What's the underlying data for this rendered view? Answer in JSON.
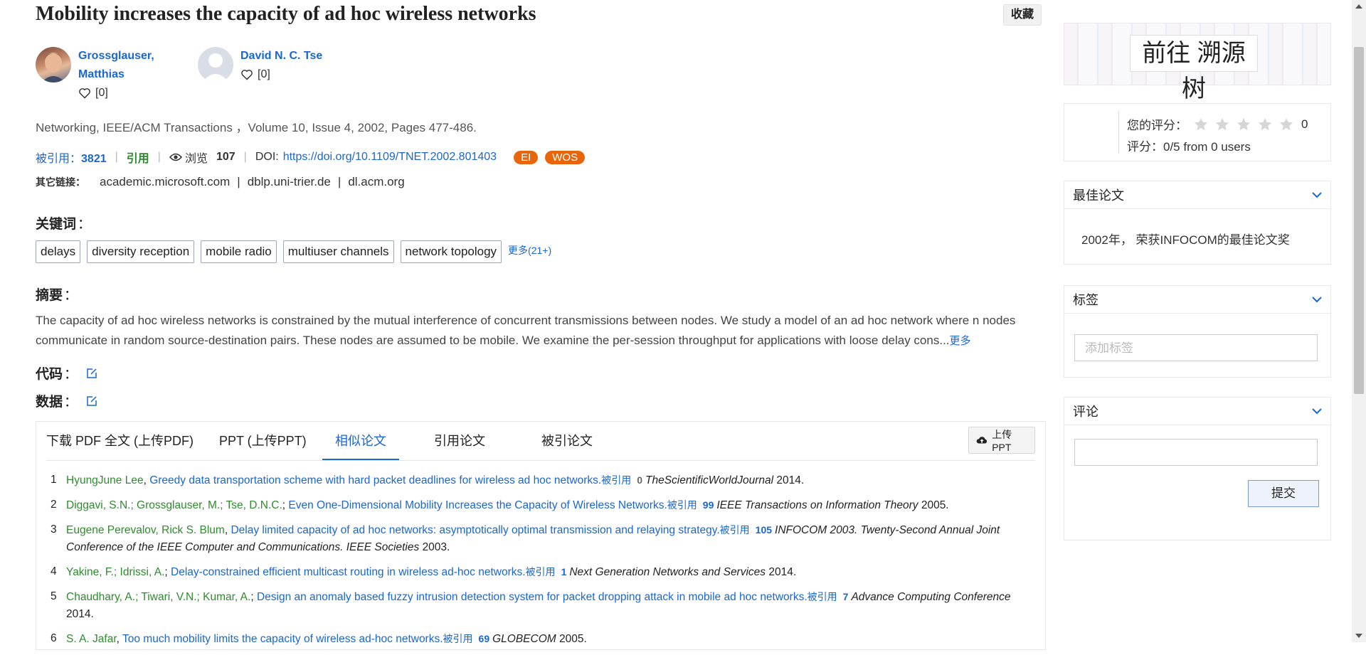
{
  "paper": {
    "title": "Mobility increases the capacity of ad hoc wireless networks",
    "favorite_label": "收藏",
    "authors": [
      {
        "name": "Grossglauser, Matthias",
        "name_line1": "Grossglauser,",
        "name_line2": "Matthias",
        "likes": "[0]"
      },
      {
        "name": "David N. C. Tse",
        "likes": "[0]"
      }
    ],
    "venue": "Networking, IEEE/ACM Transactions ，Volume 10, Issue 4, 2002, Pages 477-486.",
    "metrics": {
      "cited_label": "被引用：",
      "cited_count": "3821",
      "cite_label": "引用",
      "views_label": "浏览",
      "views": "107",
      "doi_label": "DOI:",
      "doi": "https://doi.org/10.1109/TNET.2002.801403",
      "badges": [
        "EI",
        "WOS"
      ]
    },
    "other_links": {
      "label": "其它链接：",
      "items": [
        "academic.microsoft.com",
        "dblp.uni-trier.de",
        "dl.acm.org"
      ]
    },
    "keywords_label": "关键词",
    "keywords": [
      "delays",
      "diversity reception",
      "mobile radio",
      "multiuser channels",
      "network topology"
    ],
    "keywords_more": "更多(21+)",
    "abstract_label": "摘要",
    "abstract": "The capacity of ad hoc wireless networks is constrained by the mutual interference of concurrent transmissions between nodes. We study a model of an ad hoc network where n nodes communicate in random source-destination pairs. These nodes are assumed to be mobile. We examine the per-session throughput for applications with loose delay cons...",
    "abstract_more": "更多",
    "code_label": "代码",
    "data_label": "数据",
    "colon": "："
  },
  "tabs": {
    "items": [
      "下载 PDF 全文 (上传PDF)",
      "PPT (上传PPT)",
      "相似论文",
      "引用论文",
      "被引论文"
    ],
    "active": "相似论文",
    "upload_ppt": "上传PPT"
  },
  "similar_papers": [
    {
      "num": "1",
      "authors": "HyungJune Lee",
      "title": "Greedy data transportation scheme with hard packet deadlines for wireless ad hoc networks.",
      "cite_label": "被引用",
      "cites": "0",
      "venue": "TheScientificWorldJournal",
      "year": "2014."
    },
    {
      "num": "2",
      "authors": "Diggavi, S.N.; Grossglauser, M.; Tse, D.N.C.",
      "title": "Even One-Dimensional Mobility Increases the Capacity of Wireless Networks.",
      "cite_label": "被引用",
      "cites": "99",
      "venue": "IEEE Transactions on Information Theory",
      "year": "2005."
    },
    {
      "num": "3",
      "authors": "Eugene Perevalov, Rick S. Blum",
      "title": "Delay limited capacity of ad hoc networks: asymptotically optimal transmission and relaying strategy.",
      "cite_label": "被引用",
      "cites": "105",
      "venue": "INFOCOM 2003. Twenty-Second Annual Joint Conference of the IEEE Computer and Communications. IEEE Societies",
      "year": "2003."
    },
    {
      "num": "4",
      "authors": "Yakine, F.; Idrissi, A.",
      "title": "Delay-constrained efficient multicast routing in wireless ad-hoc networks.",
      "cite_label": "被引用",
      "cites": "1",
      "venue": "Next Generation Networks and Services",
      "year": "2014."
    },
    {
      "num": "5",
      "authors": "Chaudhary, A.; Tiwari, V.N.; Kumar, A.",
      "title": "Design an anomaly based fuzzy intrusion detection system for packet dropping attack in mobile ad hoc networks.",
      "cite_label": "被引用",
      "cites": "7",
      "venue": "Advance Computing Conference",
      "year": "2014."
    },
    {
      "num": "6",
      "authors": "S. A. Jafar",
      "title": "Too much mobility limits the capacity of wireless ad-hoc networks.",
      "cite_label": "被引用",
      "cites": "69",
      "venue": "GLOBECOM",
      "year": "2005."
    }
  ],
  "sidebar": {
    "trace_button": "前往 溯源树",
    "rating": {
      "your_rating_label": "您的评分：",
      "your_rating": "0",
      "stars_filled": 0,
      "stars_total": 5,
      "summary": "评分：0/5 from 0 users"
    },
    "best_paper": {
      "title": "最佳论文",
      "text": "2002年， 荣获INFOCOM的最佳论文奖"
    },
    "tags": {
      "title": "标签",
      "placeholder": "添加标签"
    },
    "comments": {
      "title": "评论",
      "submit": "提交"
    }
  },
  "colors": {
    "link": "#1a66d2",
    "author_green": "#2e8b2e",
    "badge_orange": "#e8650a"
  }
}
